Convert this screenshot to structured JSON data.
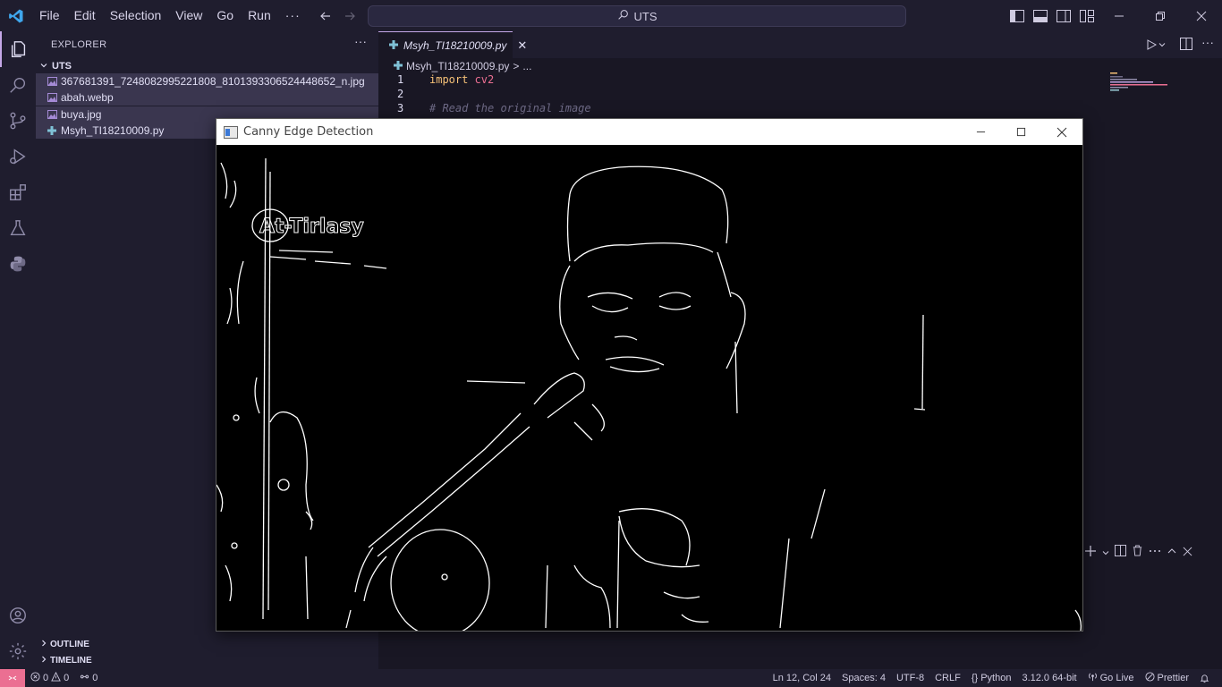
{
  "titlebar": {
    "menus": [
      "File",
      "Edit",
      "Selection",
      "View",
      "Go",
      "Run",
      "···"
    ],
    "search_text": "UTS"
  },
  "explorer": {
    "title": "EXPLORER",
    "more": "···",
    "folder": "UTS",
    "files": [
      {
        "name": "367681391_7248082995221808_8101393306524448652_n.jpg",
        "icon": "image-file-icon"
      },
      {
        "name": "abah.webp",
        "icon": "image-file-icon"
      },
      {
        "name": "buya.jpg",
        "icon": "image-file-icon"
      },
      {
        "name": "Msyh_TI18210009.py",
        "icon": "python-file-icon"
      }
    ],
    "outline": "OUTLINE",
    "timeline": "TIMELINE"
  },
  "editor": {
    "tab_label": "Msyh_TI18210009.py",
    "tab_close": "✕",
    "breadcrumb_file": "Msyh_TI18210009.py",
    "breadcrumb_sep": ">",
    "breadcrumb_rest": "...",
    "lines": [
      {
        "num": "1",
        "kw": "import",
        "mod": " cv2",
        "comment": ""
      },
      {
        "num": "2",
        "kw": "",
        "mod": "",
        "comment": ""
      },
      {
        "num": "3",
        "kw": "",
        "mod": "",
        "comment": "# Read the original image"
      }
    ]
  },
  "canny_window": {
    "title": "Canny Edge Detection",
    "overlay_text": "At-Tirlasy"
  },
  "statusbar": {
    "errors": "0",
    "warnings": "0",
    "ports": "0",
    "position": "Ln 12, Col 24",
    "spaces": "Spaces: 4",
    "encoding": "UTF-8",
    "eol": "CRLF",
    "language": "Python",
    "interpreter": "3.12.0 64-bit",
    "golive": "Go Live",
    "prettier": "Prettier"
  },
  "colors": {
    "accent": "#c4a7e7",
    "remote": "#eb6f92",
    "keyword": "#f6c177",
    "module": "#eb6f92"
  }
}
